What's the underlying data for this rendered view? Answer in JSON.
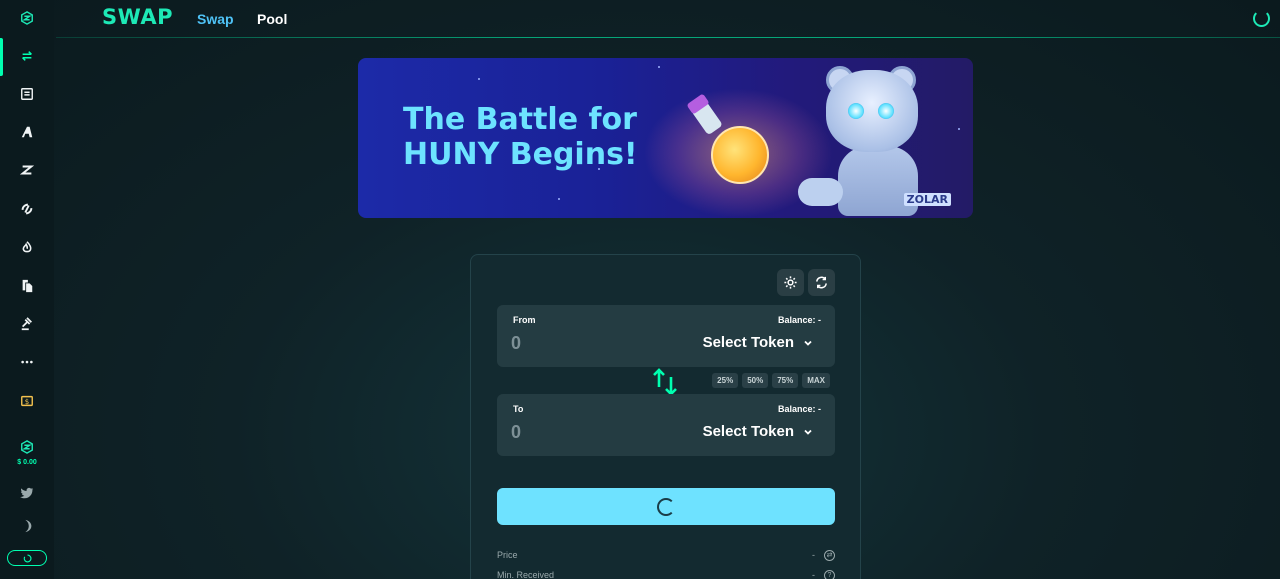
{
  "header": {
    "brand": "SWAP",
    "nav": [
      {
        "label": "Swap",
        "active": true
      },
      {
        "label": "Pool",
        "active": false
      }
    ]
  },
  "sidebar": {
    "items": [
      {
        "icon": "zilswap-logo-icon"
      },
      {
        "icon": "swap-arrows-icon",
        "active": true
      },
      {
        "icon": "newspaper-icon"
      },
      {
        "icon": "arky-icon"
      },
      {
        "icon": "z-icon"
      },
      {
        "icon": "bridge-icon"
      },
      {
        "icon": "flame-icon"
      },
      {
        "icon": "documents-icon"
      },
      {
        "icon": "gavel-icon"
      },
      {
        "icon": "more-dots-icon"
      },
      {
        "icon": "dollar-ticket-icon"
      },
      {
        "icon": "zwap-token-icon"
      },
      {
        "icon": "twitter-icon"
      },
      {
        "icon": "moon-icon"
      }
    ],
    "balance": "$ 0.00"
  },
  "banner": {
    "line1": "The Battle for",
    "line2": "HUNY Begins!",
    "tag": "ZOLAR"
  },
  "swap": {
    "from": {
      "label": "From",
      "balance": "Balance: -",
      "amount": "0",
      "token": "Select Token"
    },
    "to": {
      "label": "To",
      "balance": "Balance: -",
      "amount": "0",
      "token": "Select Token"
    },
    "percentages": [
      "25%",
      "50%",
      "75%",
      "MAX"
    ],
    "info": [
      {
        "label": "Price",
        "value": "-"
      },
      {
        "label": "Min. Received",
        "value": "-"
      }
    ]
  },
  "colors": {
    "accent": "#00ffb0",
    "brand": "#1de9b6",
    "nav_active": "#4fc3f7",
    "button": "#6ee2ff",
    "card": "#132a30",
    "panel": "#243c42"
  }
}
